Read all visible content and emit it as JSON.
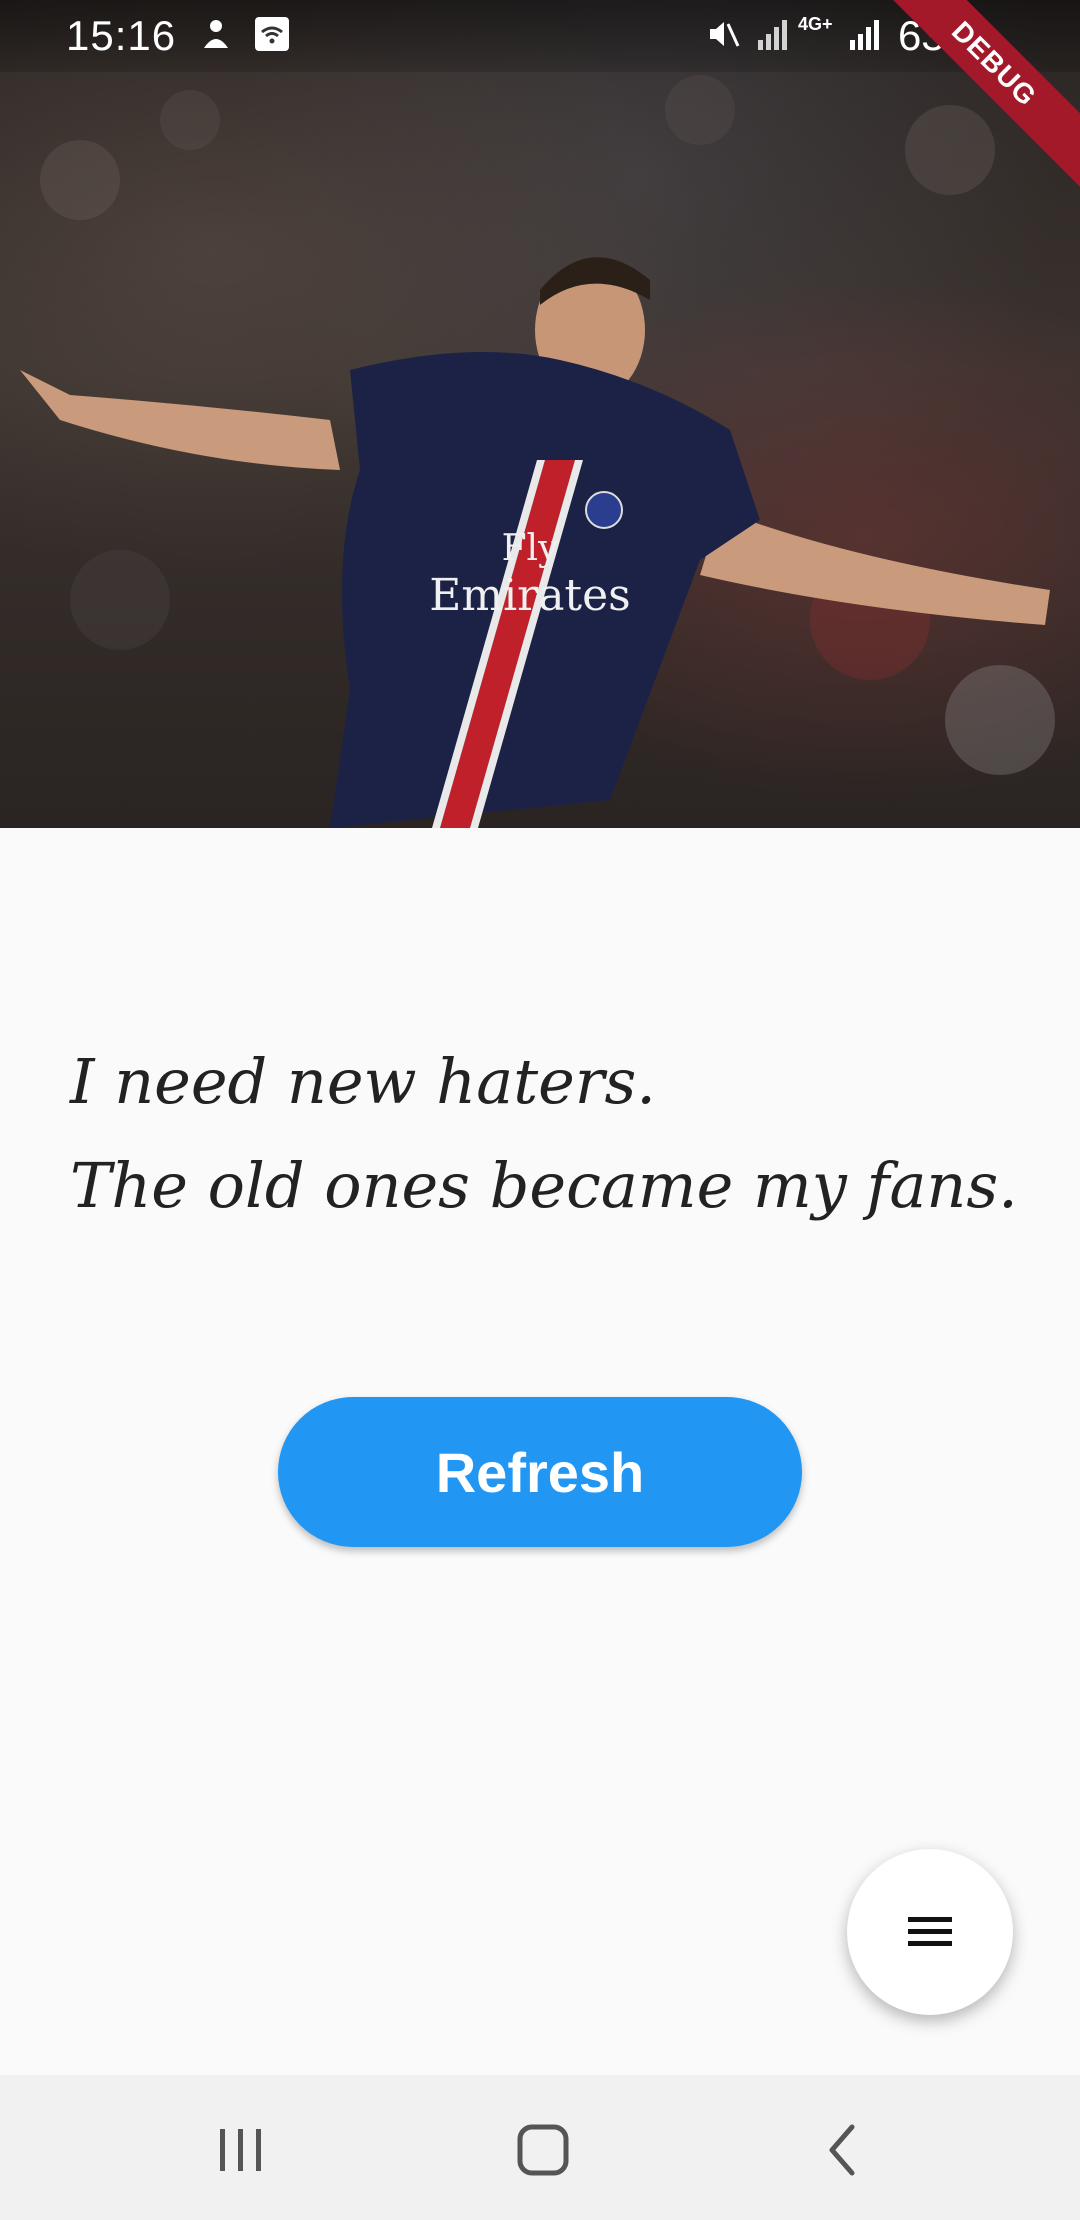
{
  "status_bar": {
    "time": "15:16",
    "battery": "63%",
    "network": "4G+",
    "icons": [
      "user-icon",
      "wifi-icon",
      "mute-icon",
      "signal-icon",
      "signal-4g-icon",
      "signal-icon",
      "battery-icon"
    ]
  },
  "debug_banner": "DEBUG",
  "hero": {
    "image_subject": "footballer celebrating with arms outstretched",
    "shirt_text": [
      "Fly",
      "Emirates"
    ]
  },
  "quote": {
    "line1": "I need new haters.",
    "line2": "The old ones became my fans."
  },
  "refresh_button": {
    "label": "Refresh",
    "color": "#2196f3"
  },
  "fab": {
    "icon": "menu-icon"
  },
  "nav_bar": {
    "buttons": [
      "recents-icon",
      "home-icon",
      "back-icon"
    ]
  }
}
